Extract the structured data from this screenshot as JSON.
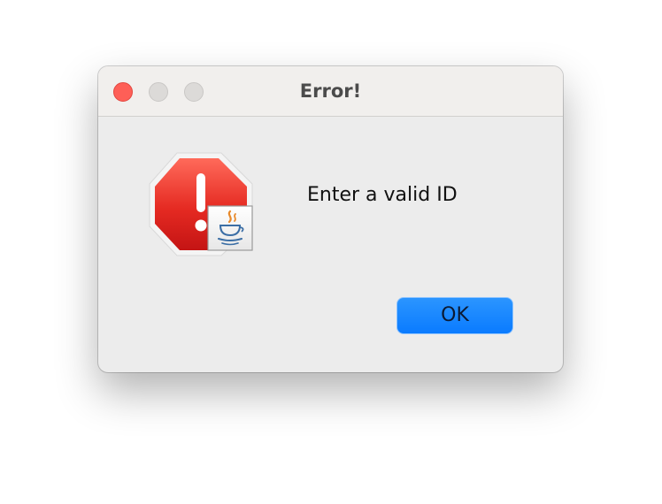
{
  "window": {
    "title": "Error!",
    "controls": {
      "close": "close-button",
      "minimize": "minimize-button",
      "zoom": "zoom-button"
    }
  },
  "dialog": {
    "icon": "error-stop-icon",
    "badge_icon": "java-cup-icon",
    "message": "Enter a valid ID",
    "ok_label": "OK"
  },
  "colors": {
    "accent_button": "#0a7bff",
    "close_light": "#fe5f57",
    "stop_red": "#d81e1e"
  }
}
